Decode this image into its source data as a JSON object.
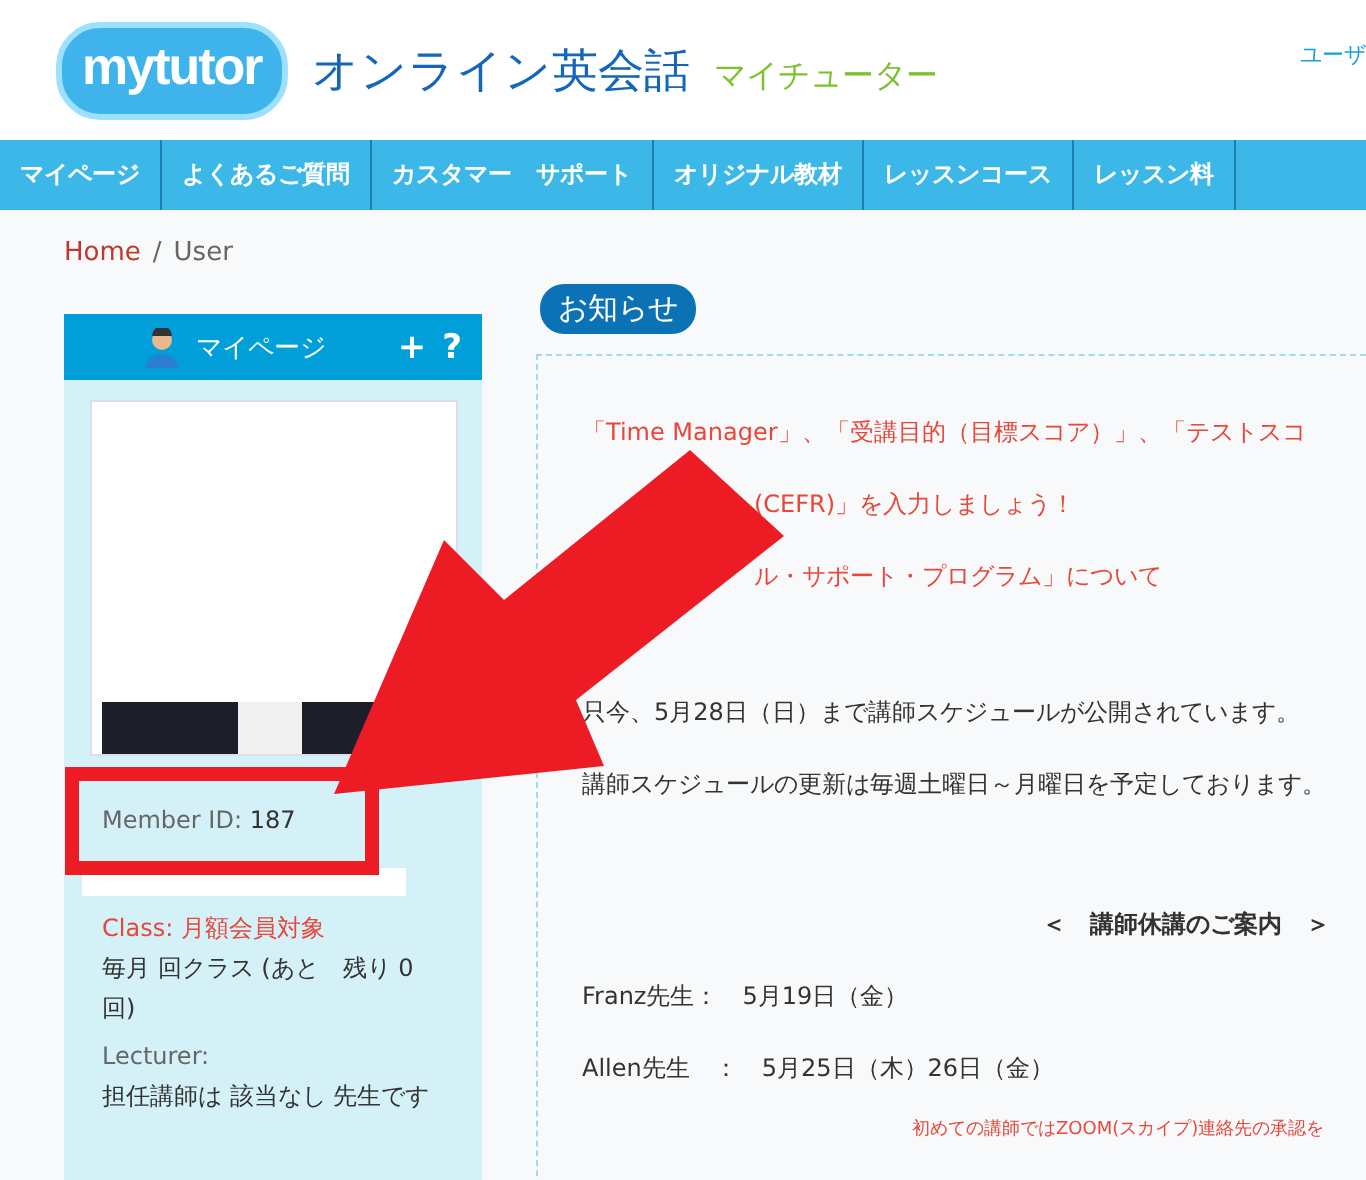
{
  "header": {
    "logo": "mytutor",
    "title": "オンライン英会話",
    "subtitle": "マイチューター",
    "user_link": "ユーザ"
  },
  "nav": [
    {
      "label": "マイページ"
    },
    {
      "label": "よくあるご質問"
    },
    {
      "label": "カスタマー　サポート"
    },
    {
      "label": "オリジナル教材"
    },
    {
      "label": "レッスンコース"
    },
    {
      "label": "レッスン料"
    }
  ],
  "breadcrumb": [
    {
      "label": "Home",
      "kind": "link"
    },
    {
      "label": "/",
      "kind": "separator"
    },
    {
      "label": "User",
      "kind": "current"
    }
  ],
  "sidebar": {
    "title": "マイページ",
    "actions": [
      "+",
      "?"
    ],
    "photo": {
      "kind": "picture"
    },
    "member_id": {
      "label": "Member ID:",
      "value": "187"
    },
    "class": {
      "label": "Class:",
      "value": "月額会員対象"
    },
    "class_detail": "毎月 回クラス (あと　残り 0回)",
    "lecturer": {
      "label": "Lecturer:",
      "value": "担任講師は 該当なし 先生です"
    }
  },
  "notice": {
    "badge": "お知らせ",
    "links": [
      {
        "text": "「Time Manager」、「受講目的（目標スコア）」、「テストスコ"
      },
      {
        "text": "(CEFR)」を入力しましょう！"
      },
      {
        "text": "ル・サポート・プログラム」について"
      }
    ],
    "paragraphs": [
      "只今、5月28日（日）まで講師スケジュールが公開されています。",
      "講師スケジュールの更新は毎週土曜日～月曜日を予定しております。"
    ],
    "holiday_heading": "＜　講師休講のご案内　＞",
    "holidays": [
      "Franz先生：　5月19日（金）",
      "Allen先生　：　5月25日（木）26日（金）"
    ],
    "footnote": "初めての講師ではZOOM(スカイプ)連絡先の承認を"
  },
  "annotation": {
    "arrow": true,
    "frame": true
  }
}
